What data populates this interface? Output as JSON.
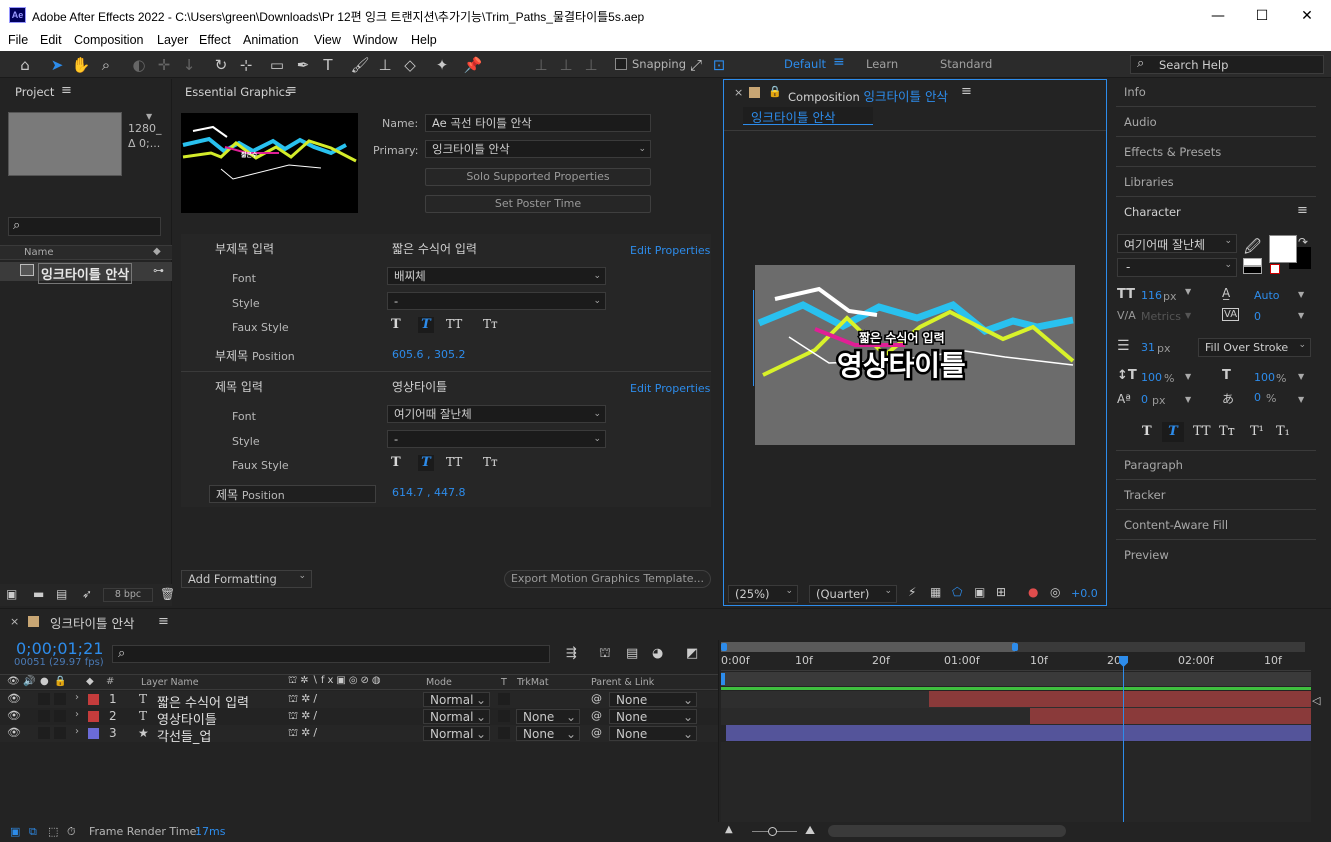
{
  "window": {
    "app_badge": "Ae",
    "title": "Adobe After Effects 2022 - C:\\Users\\green\\Downloads\\Pr 12편 잉크 트랜지션\\추가기능\\Trim_Paths_물결타이틀5s.aep",
    "minimize": "—",
    "maximize": "☐",
    "close": "✕"
  },
  "menu": [
    "File",
    "Edit",
    "Composition",
    "Layer",
    "Effect",
    "Animation",
    "View",
    "Window",
    "Help"
  ],
  "toolbar": {
    "snapping": "Snapping",
    "workspaces": [
      "Default",
      "Learn",
      "Standard"
    ],
    "search_placeholder": "Search Help"
  },
  "project": {
    "title": "Project",
    "thumb_info": [
      "1280_",
      "Δ 0;..."
    ],
    "name_col": "Name",
    "items": [
      "잉크타이틀 안삭"
    ],
    "bpc": "8 bpc"
  },
  "essential": {
    "title": "Essential Graphics",
    "name_label": "Name:",
    "name_value": "Ae 곡선 타이틀 안삭",
    "primary_label": "Primary:",
    "primary_value": "잉크타이틀 안삭",
    "solo_btn": "Solo Supported Properties",
    "poster_btn": "Set Poster Time",
    "group1": {
      "title": "부제목 입력",
      "text": "짧은 수식어 입력",
      "edit": "Edit Properties",
      "font_label": "Font",
      "font_value": "배찌체",
      "style_label": "Style",
      "style_value": "-",
      "faux_label": "Faux Style",
      "pos_label_kor": "부제목",
      "pos_label": "Position",
      "pos_value": "605.6 , 305.2"
    },
    "group2": {
      "title": "제목 입력",
      "text": "영상타이틀",
      "edit": "Edit Properties",
      "font_label": "Font",
      "font_value": "여기어때 잘난체",
      "style_label": "Style",
      "style_value": "-",
      "faux_label": "Faux Style",
      "pos_label_kor": "제목",
      "pos_label": "Position",
      "pos_value": "614.7 , 447.8"
    },
    "faux_glyphs": [
      "T",
      "T",
      "TT",
      "Tт"
    ],
    "add_formatting": "Add Formatting",
    "export_btn": "Export Motion Graphics Template..."
  },
  "composition": {
    "title_prefix": "Composition",
    "title_name": "잉크타이틀 안삭",
    "tab": "잉크타이틀 안삭",
    "sub_text": "짧은 수식어 입력",
    "main_text": "영상타이틀",
    "zoom": "(25%)",
    "quality": "(Quarter)",
    "exposure": "+0.0"
  },
  "right": {
    "items_top": [
      "Info",
      "Audio",
      "Effects & Presets",
      "Libraries"
    ],
    "character_title": "Character",
    "font": "여기어때 잘난체",
    "style": "-",
    "size": "116",
    "size_unit": "px",
    "leading": "Auto",
    "kerning": "Metrics",
    "tracking": "0",
    "stroke_width": "31",
    "stroke_unit": "px",
    "stroke_type": "Fill Over Stroke",
    "vscale": "100",
    "hscale": "100",
    "pct": "%",
    "baseline": "0",
    "baseline_unit": "px",
    "tsume": "0",
    "tsume_unit": "%",
    "style_buttons": [
      "T",
      "T",
      "TT",
      "Tт",
      "T¹",
      "T₁"
    ],
    "items_bottom": [
      "Paragraph",
      "Tracker",
      "Content-Aware Fill",
      "Preview"
    ]
  },
  "timeline": {
    "comp_name": "잉크타이틀 안삭",
    "timecode": "0;00;01;21",
    "frame_info": "00051 (29.97 fps)",
    "cols": {
      "num": "#",
      "layer_name": "Layer Name",
      "mode": "Mode",
      "t": "T",
      "trkmat": "TrkMat",
      "parent": "Parent & Link"
    },
    "ruler": [
      "0:00f",
      "10f",
      "20f",
      "01:00f",
      "10f",
      "20f",
      "02:00f",
      "10f"
    ],
    "layers": [
      {
        "num": "1",
        "type": "T",
        "name": "짧은 수식어 입력",
        "color": "#c43c3c",
        "mode": "Normal",
        "trkmat": "",
        "parent": "None"
      },
      {
        "num": "2",
        "type": "T",
        "name": "영상타이틀",
        "color": "#c43c3c",
        "mode": "Normal",
        "trkmat": "None",
        "parent": "None"
      },
      {
        "num": "3",
        "type": "★",
        "name": "각선들_업",
        "color": "#6b6bd6",
        "mode": "Normal",
        "trkmat": "None",
        "parent": "None"
      }
    ],
    "render_label": "Frame Render Time:",
    "render_value": "17ms"
  }
}
